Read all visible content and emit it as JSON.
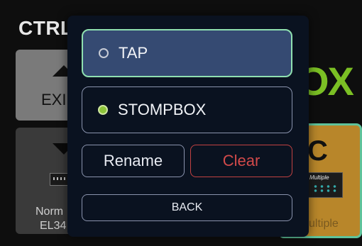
{
  "background": {
    "title": "CTRL",
    "tiles": {
      "exit_label": "EXI",
      "norm_label_line1": "Norm",
      "norm_label_line2": "EL34",
      "right_big_text": "OX",
      "multiple_tile_letter": "C",
      "multiple_device_text": "Multiple",
      "multiple_label": "ultiple"
    }
  },
  "modal": {
    "options": [
      {
        "label": "TAP",
        "selected": false
      },
      {
        "label": "STOMPBOX",
        "selected": true
      }
    ],
    "rename_label": "Rename",
    "clear_label": "Clear",
    "back_label": "BACK"
  },
  "colors": {
    "modal_bg": "#0a1220",
    "tap_bg": "#354a72",
    "tap_border": "#8fe0b0",
    "selected_radio": "#8dc43a",
    "clear_red": "#d24a4a",
    "stompbox_green": "#7bbf24",
    "multiple_tile_bg": "#b8862a"
  }
}
